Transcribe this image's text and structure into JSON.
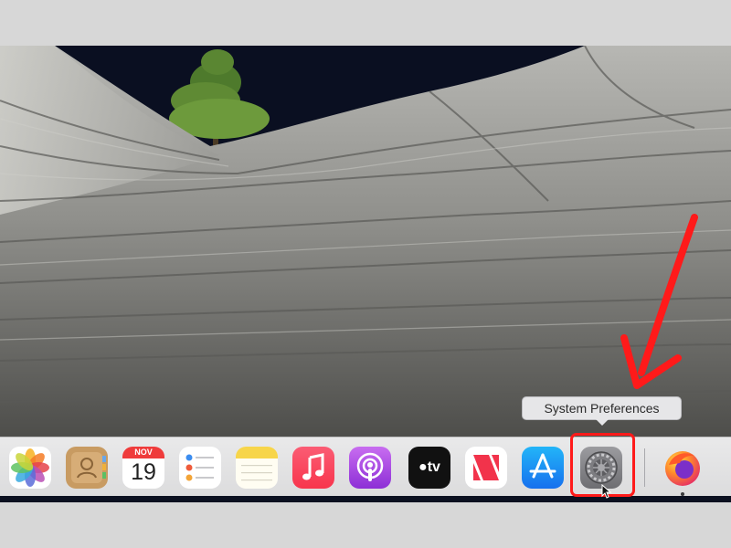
{
  "tooltip": {
    "text": "System Preferences"
  },
  "dock": {
    "items": [
      {
        "id": "photos",
        "icon": "photos-icon"
      },
      {
        "id": "contacts",
        "icon": "contacts-icon"
      },
      {
        "id": "calendar",
        "icon": "calendar-icon",
        "month": "NOV",
        "day": "19"
      },
      {
        "id": "reminders",
        "icon": "reminders-icon"
      },
      {
        "id": "notes",
        "icon": "notes-icon"
      },
      {
        "id": "music",
        "icon": "music-icon"
      },
      {
        "id": "podcasts",
        "icon": "podcasts-icon"
      },
      {
        "id": "apple-tv",
        "icon": "apple-tv-icon",
        "label": "tv"
      },
      {
        "id": "news",
        "icon": "news-icon"
      },
      {
        "id": "app-store",
        "icon": "app-store-icon"
      },
      {
        "id": "system-preferences",
        "icon": "gear-icon",
        "highlighted": true
      },
      {
        "id": "firefox",
        "icon": "firefox-icon",
        "running": true
      }
    ]
  },
  "colors": {
    "annotation": "#ff1a1a",
    "dock_background": "#e4e4e6"
  }
}
